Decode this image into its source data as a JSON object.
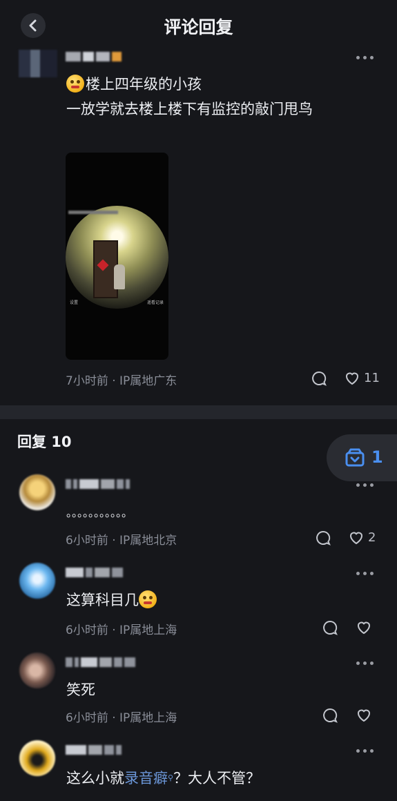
{
  "header": {
    "title": "评论回复"
  },
  "main_comment": {
    "line1": "楼上四年级的小孩",
    "line2": "一放学就去楼上楼下有监控的敲门甩鸟",
    "video_overlay_left": "设置",
    "video_overlay_right": "遥看记录",
    "meta": "7小时前 · IP属地广东",
    "like_count": "11"
  },
  "replies_section": {
    "title": "回复 10",
    "favorite_count": "1"
  },
  "replies": [
    {
      "text": "。。。。。。。。。。。",
      "meta": "6小时前 · IP属地北京",
      "like_count": "2"
    },
    {
      "text": "这算科目几",
      "meta": "6小时前 · IP属地上海",
      "like_count": ""
    },
    {
      "text": "笑死",
      "meta": "6小时前 · IP属地上海",
      "like_count": ""
    },
    {
      "text_before": "这么小就",
      "link": "录音癖",
      "text_after": "？大人不管？"
    }
  ],
  "colors": {
    "background": "#16171b",
    "accent": "#4a8ff0",
    "link": "#6a95d6"
  }
}
